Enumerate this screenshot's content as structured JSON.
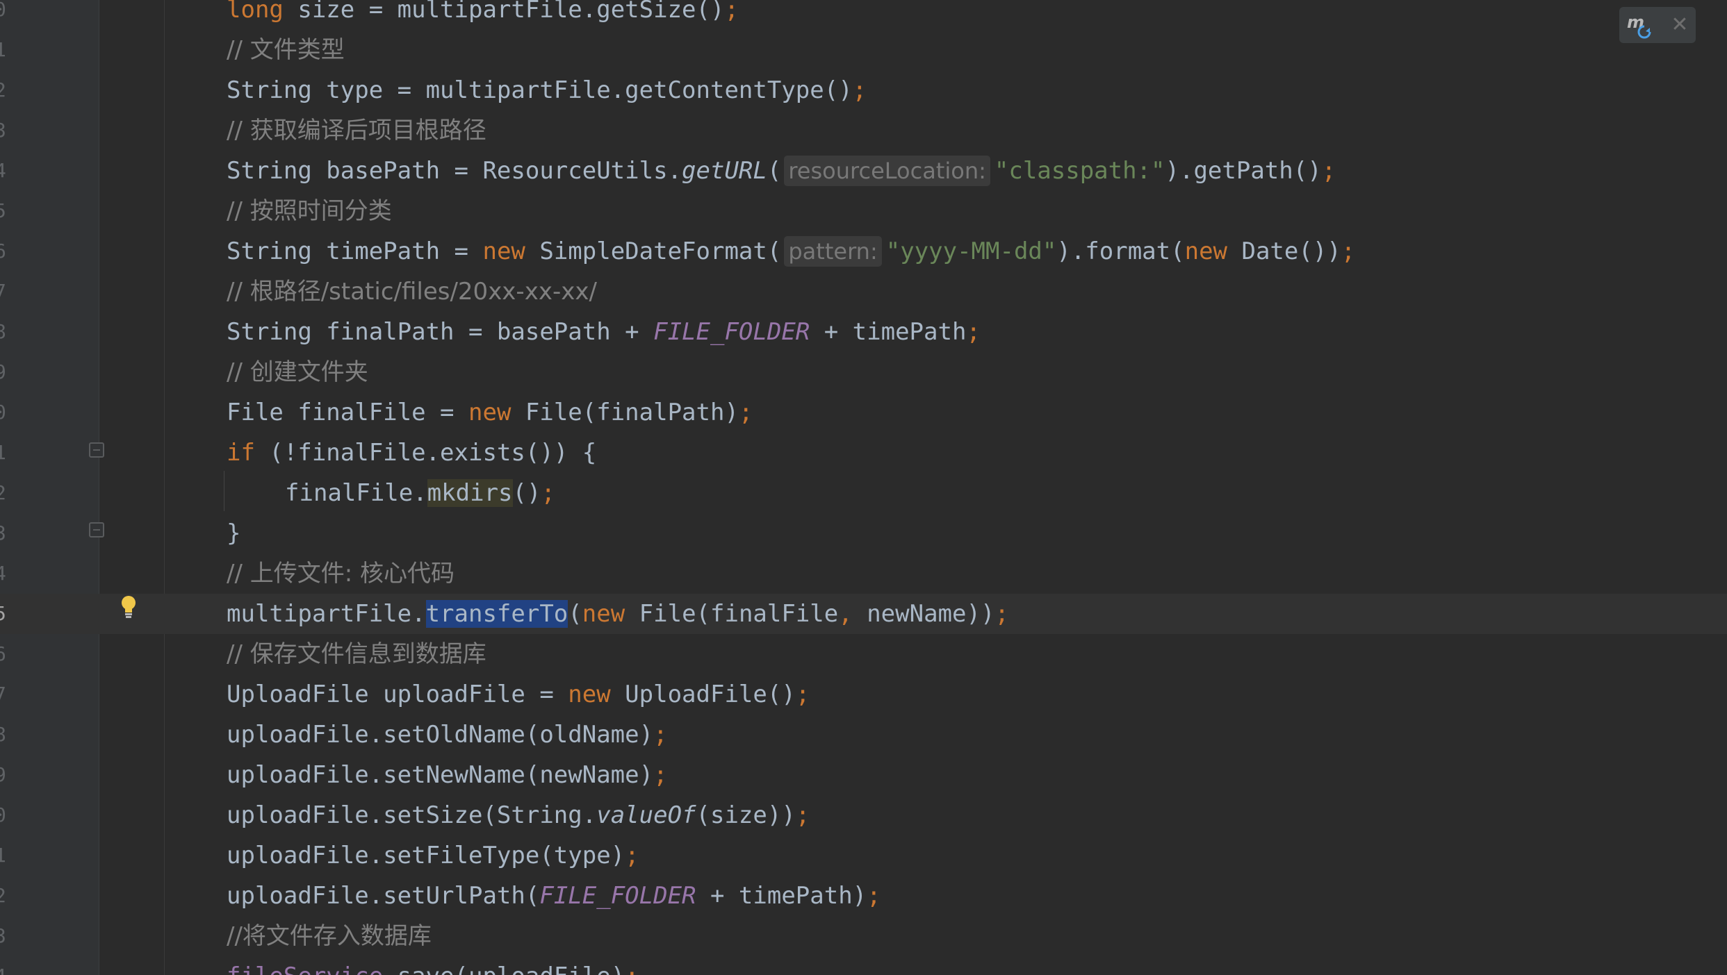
{
  "editor": {
    "lines": [
      {
        "no": "0",
        "html": "<span class=\"kw\">long</span> size = multipartFile.getSize()<span class=\"semi\">;</span>"
      },
      {
        "no": "1",
        "html": "<span class=\"cmt\">// 文件类型</span>"
      },
      {
        "no": "2",
        "html": "String type = multipartFile.getContentType()<span class=\"semi\">;</span>"
      },
      {
        "no": "3",
        "html": "<span class=\"cmt\">// 获取编译后项目根路径</span>"
      },
      {
        "no": "4",
        "html": "String basePath = ResourceUtils.<span class=\"ital\">getURL</span>(<span class=\"hint\">resourceLocation:</span><span class=\"str\">\"classpath:\"</span>).getPath()<span class=\"semi\">;</span>"
      },
      {
        "no": "5",
        "html": "<span class=\"cmt\">// 按照时间分类</span>"
      },
      {
        "no": "6",
        "html": "String timePath = <span class=\"kw\">new</span> SimpleDateFormat(<span class=\"hint\">pattern:</span><span class=\"str\">\"yyyy-MM-dd\"</span>).format(<span class=\"kw\">new</span> Date())<span class=\"semi\">;</span>"
      },
      {
        "no": "7",
        "html": "<span class=\"cmt\">// 根路径/static/files/20xx-xx-xx/</span>"
      },
      {
        "no": "8",
        "html": "String finalPath = basePath + <span class=\"const\">FILE_FOLDER</span> + timePath<span class=\"semi\">;</span>"
      },
      {
        "no": "9",
        "html": "<span class=\"cmt\">// 创建文件夹</span>"
      },
      {
        "no": "0",
        "html": "File finalFile = <span class=\"kw\">new</span> File(finalPath)<span class=\"semi\">;</span>"
      },
      {
        "no": "1",
        "html": "<span class=\"kw\">if</span> (!finalFile.exists()) {"
      },
      {
        "no": "2",
        "html": "finalFile.<span class=\"hl-word\">mkdirs</span>()<span class=\"semi\">;</span>",
        "indent": true
      },
      {
        "no": "3",
        "html": "}"
      },
      {
        "no": "4",
        "html": "<span class=\"cmt\">// 上传文件: 核心代码</span>"
      },
      {
        "no": "5",
        "html": "multipartFile.<span class=\"sel-word\">transferTo</span>(<span class=\"kw\">new</span> File(finalFile<span class=\"semi\">,</span> newName))<span class=\"semi\">;</span>",
        "caret": true
      },
      {
        "no": "6",
        "html": "<span class=\"cmt\">// 保存文件信息到数据库</span>"
      },
      {
        "no": "7",
        "html": "UploadFile uploadFile = <span class=\"kw\">new</span> UploadFile()<span class=\"semi\">;</span>"
      },
      {
        "no": "8",
        "html": "uploadFile.setOldName(oldName)<span class=\"semi\">;</span>"
      },
      {
        "no": "9",
        "html": "uploadFile.setNewName(newName)<span class=\"semi\">;</span>"
      },
      {
        "no": "0",
        "html": "uploadFile.setSize(String.<span class=\"ital\">valueOf</span>(size))<span class=\"semi\">;</span>"
      },
      {
        "no": "1",
        "html": "uploadFile.setFileType(type)<span class=\"semi\">;</span>"
      },
      {
        "no": "2",
        "html": "uploadFile.setUrlPath(<span class=\"const\">FILE_FOLDER</span> + timePath)<span class=\"semi\">;</span>"
      },
      {
        "no": "3",
        "html": "<span class=\"cmt\">//将文件存入数据库</span>"
      },
      {
        "no": "4",
        "html": "<span class=\"const\" style=\"font-style:normal\">fileService</span>.save(uploadFile)<span class=\"semi\">;</span>"
      }
    ]
  },
  "widget": {
    "maven_icon": "maven-reload-icon",
    "close_glyph": "✕"
  },
  "colors": {
    "background": "#2b2b2b",
    "gutter": "#313335",
    "keyword": "#cc7832",
    "string": "#6a8759",
    "comment": "#808080",
    "constant": "#9876aa",
    "selection": "#214283"
  }
}
